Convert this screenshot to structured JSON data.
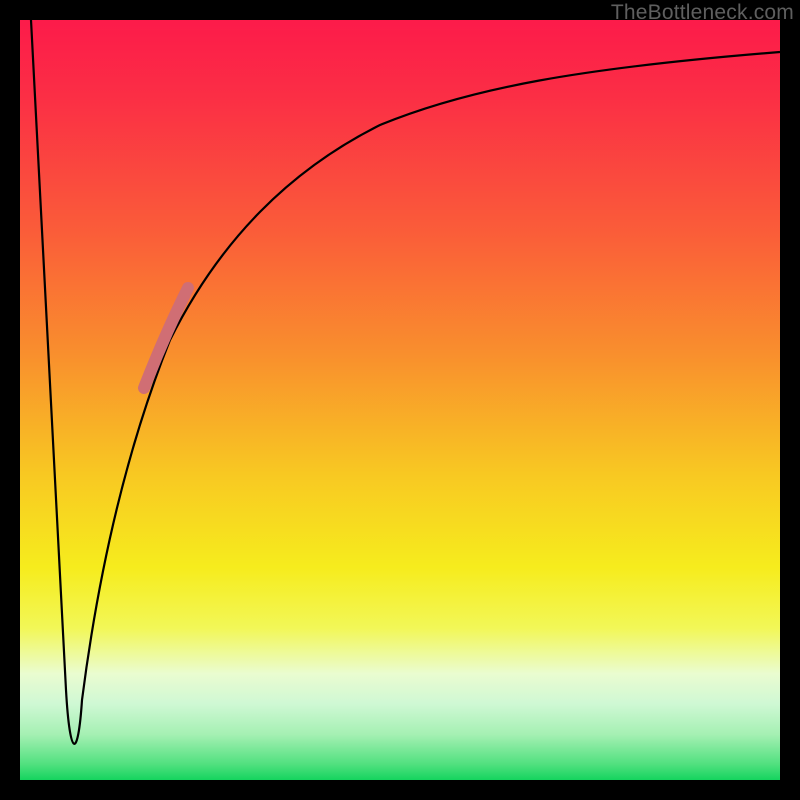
{
  "attribution": "TheBottleneck.com",
  "chart_data": {
    "type": "line",
    "title": "",
    "xlabel": "",
    "ylabel": "",
    "xlim": [
      0,
      100
    ],
    "ylim": [
      0,
      100
    ],
    "grid": false,
    "legend": false,
    "series": [
      {
        "name": "bottleneck-curve",
        "stroke": "#000000",
        "stroke_width": 2,
        "points": [
          {
            "x": 1.5,
            "y": 100
          },
          {
            "x": 3.0,
            "y": 70
          },
          {
            "x": 4.5,
            "y": 40
          },
          {
            "x": 6.0,
            "y": 12
          },
          {
            "x": 7.0,
            "y": 3
          },
          {
            "x": 8.0,
            "y": 3
          },
          {
            "x": 9.5,
            "y": 15
          },
          {
            "x": 12.0,
            "y": 34
          },
          {
            "x": 16.0,
            "y": 52
          },
          {
            "x": 20.0,
            "y": 62
          },
          {
            "x": 26.0,
            "y": 72
          },
          {
            "x": 34.0,
            "y": 80
          },
          {
            "x": 44.0,
            "y": 86
          },
          {
            "x": 56.0,
            "y": 90
          },
          {
            "x": 70.0,
            "y": 93
          },
          {
            "x": 85.0,
            "y": 95
          },
          {
            "x": 100.0,
            "y": 96
          }
        ]
      },
      {
        "name": "highlight-segment",
        "stroke": "#d06e74",
        "stroke_width": 10,
        "linecap": "round",
        "points": [
          {
            "x": 16.5,
            "y": 53
          },
          {
            "x": 19.0,
            "y": 60
          },
          {
            "x": 21.5,
            "y": 65
          }
        ]
      }
    ],
    "annotations": []
  }
}
